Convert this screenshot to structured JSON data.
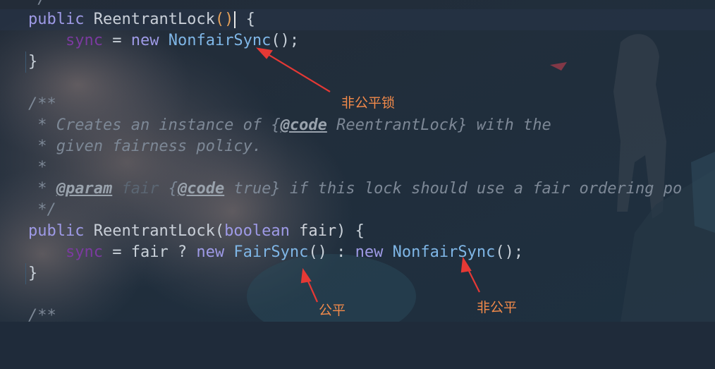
{
  "code_lines": {
    "l0": "*/",
    "l1": {
      "kw": "public",
      "name": "ReentrantLock",
      "open": "(",
      "close": ")",
      "brace": " {"
    },
    "l2": {
      "field": "sync",
      "eq": " = ",
      "kw": "new",
      "cls": "NonfairSync",
      "tail": "();"
    },
    "l3": "}",
    "l5": "/**",
    "l6": {
      "a": " * Creates an instance of {",
      "tag": "@code",
      "b": " ReentrantLock} with the"
    },
    "l7": " * given fairness policy.",
    "l8": " *",
    "l9": {
      "a": " * ",
      "tag": "@param",
      "p": " fair ",
      "b": "{",
      "tag2": "@code",
      "c": " true} if this lock should use a fair ordering po"
    },
    "l10": " */",
    "l11": {
      "kw": "public",
      "name": "ReentrantLock",
      "open": "(",
      "kw2": "boolean",
      "arg": " fair",
      "close": ")",
      "brace": " {"
    },
    "l12": {
      "field": "sync",
      "eq": " = fair ? ",
      "kw": "new",
      "cls": "FairSync",
      "mid": "() : ",
      "kw2": "new",
      "cls2": "NonfairSync",
      "tail": "();"
    },
    "l13": "}",
    "l15": "/**"
  },
  "annotations": {
    "nonfair_lock": "非公平锁",
    "fair": "公平",
    "nonfair": "非公平"
  },
  "colors": {
    "annotation": "#f28a4a",
    "arrow": "#e53935",
    "keyword": "#9e9ae6",
    "class": "#7fb6e6",
    "comment": "#7d8896",
    "field": "#7b3aa0"
  }
}
